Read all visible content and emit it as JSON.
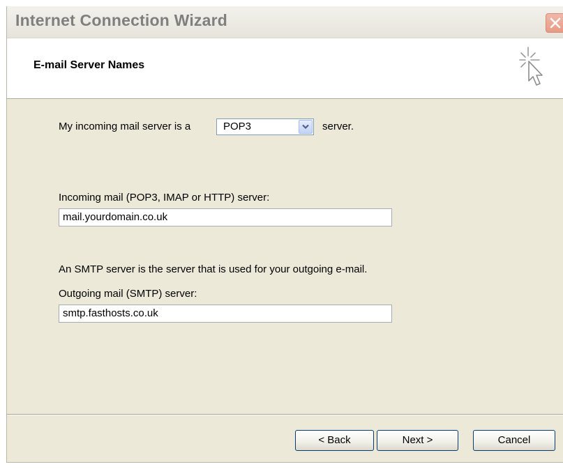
{
  "window": {
    "title": "Internet Connection Wizard"
  },
  "header": {
    "title": "E-mail Server Names",
    "icon": "wizard-cursor-icon"
  },
  "form": {
    "incoming_prefix": "My incoming mail server is a",
    "server_type_selected": "POP3",
    "incoming_suffix": "server.",
    "incoming_label": "Incoming mail (POP3, IMAP or HTTP) server:",
    "incoming_value": "mail.yourdomain.co.uk",
    "smtp_description": "An SMTP server is the server that is used for your outgoing e-mail.",
    "outgoing_label": "Outgoing mail (SMTP) server:",
    "outgoing_value": "smtp.fasthosts.co.uk"
  },
  "buttons": {
    "back": "< Back",
    "next": "Next >",
    "cancel": "Cancel"
  },
  "colors": {
    "dialog_bg": "#ece9d8",
    "close_button": "#e89a84",
    "button_border": "#003c74"
  }
}
